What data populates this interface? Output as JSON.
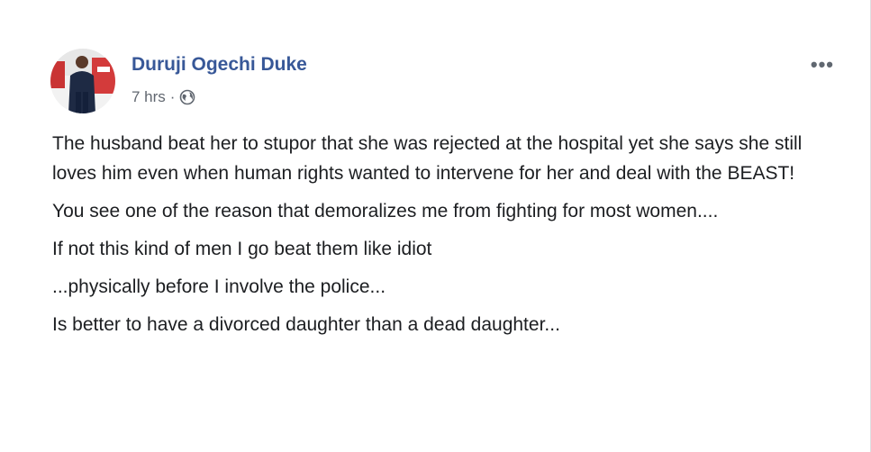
{
  "post": {
    "author": "Duruji Ogechi Duke",
    "time": "7 hrs",
    "separator": "·",
    "privacy_icon": "globe-icon",
    "more_icon": "more-options-icon",
    "more_label": "•••",
    "paragraphs": [
      "The husband beat her to stupor that she was rejected at the hospital yet she says she still loves him even when human rights wanted to intervene for her and deal with the BEAST!",
      "You see one of the reason that demoralizes me from fighting for most women....",
      "If not this kind of men I go beat them like idiot",
      "...physically before I involve the police...",
      "Is better to have a divorced daughter than a dead daughter..."
    ]
  },
  "colors": {
    "author_link": "#385898",
    "meta_text": "#616770",
    "body_text": "#1c1e21",
    "border": "#dddfe2"
  }
}
